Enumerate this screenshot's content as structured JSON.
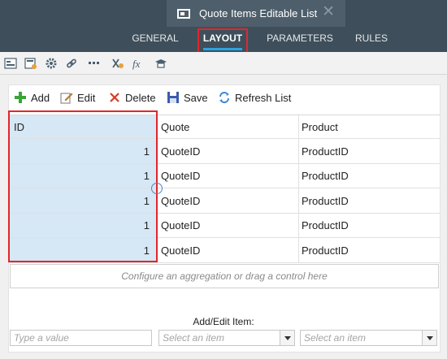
{
  "window": {
    "title": "Quote Items Editable List",
    "close_glyph": "✕"
  },
  "nav": {
    "tabs": [
      {
        "label": "GENERAL"
      },
      {
        "label": "LAYOUT",
        "active": true
      },
      {
        "label": "PARAMETERS"
      },
      {
        "label": "RULES"
      }
    ]
  },
  "designer_toolbar": {
    "icons": [
      "form-layout-icon",
      "properties-icon",
      "settings-gear-icon",
      "link-icon",
      "more-dots-icon",
      "variable-icon",
      "expression-fx-icon",
      "graduation-cap-icon"
    ]
  },
  "list": {
    "commands": {
      "add": "Add",
      "edit": "Edit",
      "delete": "Delete",
      "save": "Save",
      "refresh": "Refresh List"
    },
    "columns": [
      "ID",
      "Quote",
      "Product"
    ],
    "rows": [
      {
        "id": "1",
        "quote": "QuoteID",
        "product": "ProductID"
      },
      {
        "id": "1",
        "quote": "QuoteID",
        "product": "ProductID"
      },
      {
        "id": "1",
        "quote": "QuoteID",
        "product": "ProductID"
      },
      {
        "id": "1",
        "quote": "QuoteID",
        "product": "ProductID"
      },
      {
        "id": "1",
        "quote": "QuoteID",
        "product": "ProductID"
      }
    ],
    "aggregation_hint": "Configure an aggregation or drag a control here"
  },
  "add_edit": {
    "label": "Add/Edit Item:",
    "value_placeholder": "Type a value",
    "select1_placeholder": "Select an item",
    "select2_placeholder": "Select an item"
  },
  "colors": {
    "chrome": "#3e4f5b",
    "accent": "#2aa4e0",
    "highlight": "#e0272d",
    "selected_column": "#d6e7f5"
  }
}
